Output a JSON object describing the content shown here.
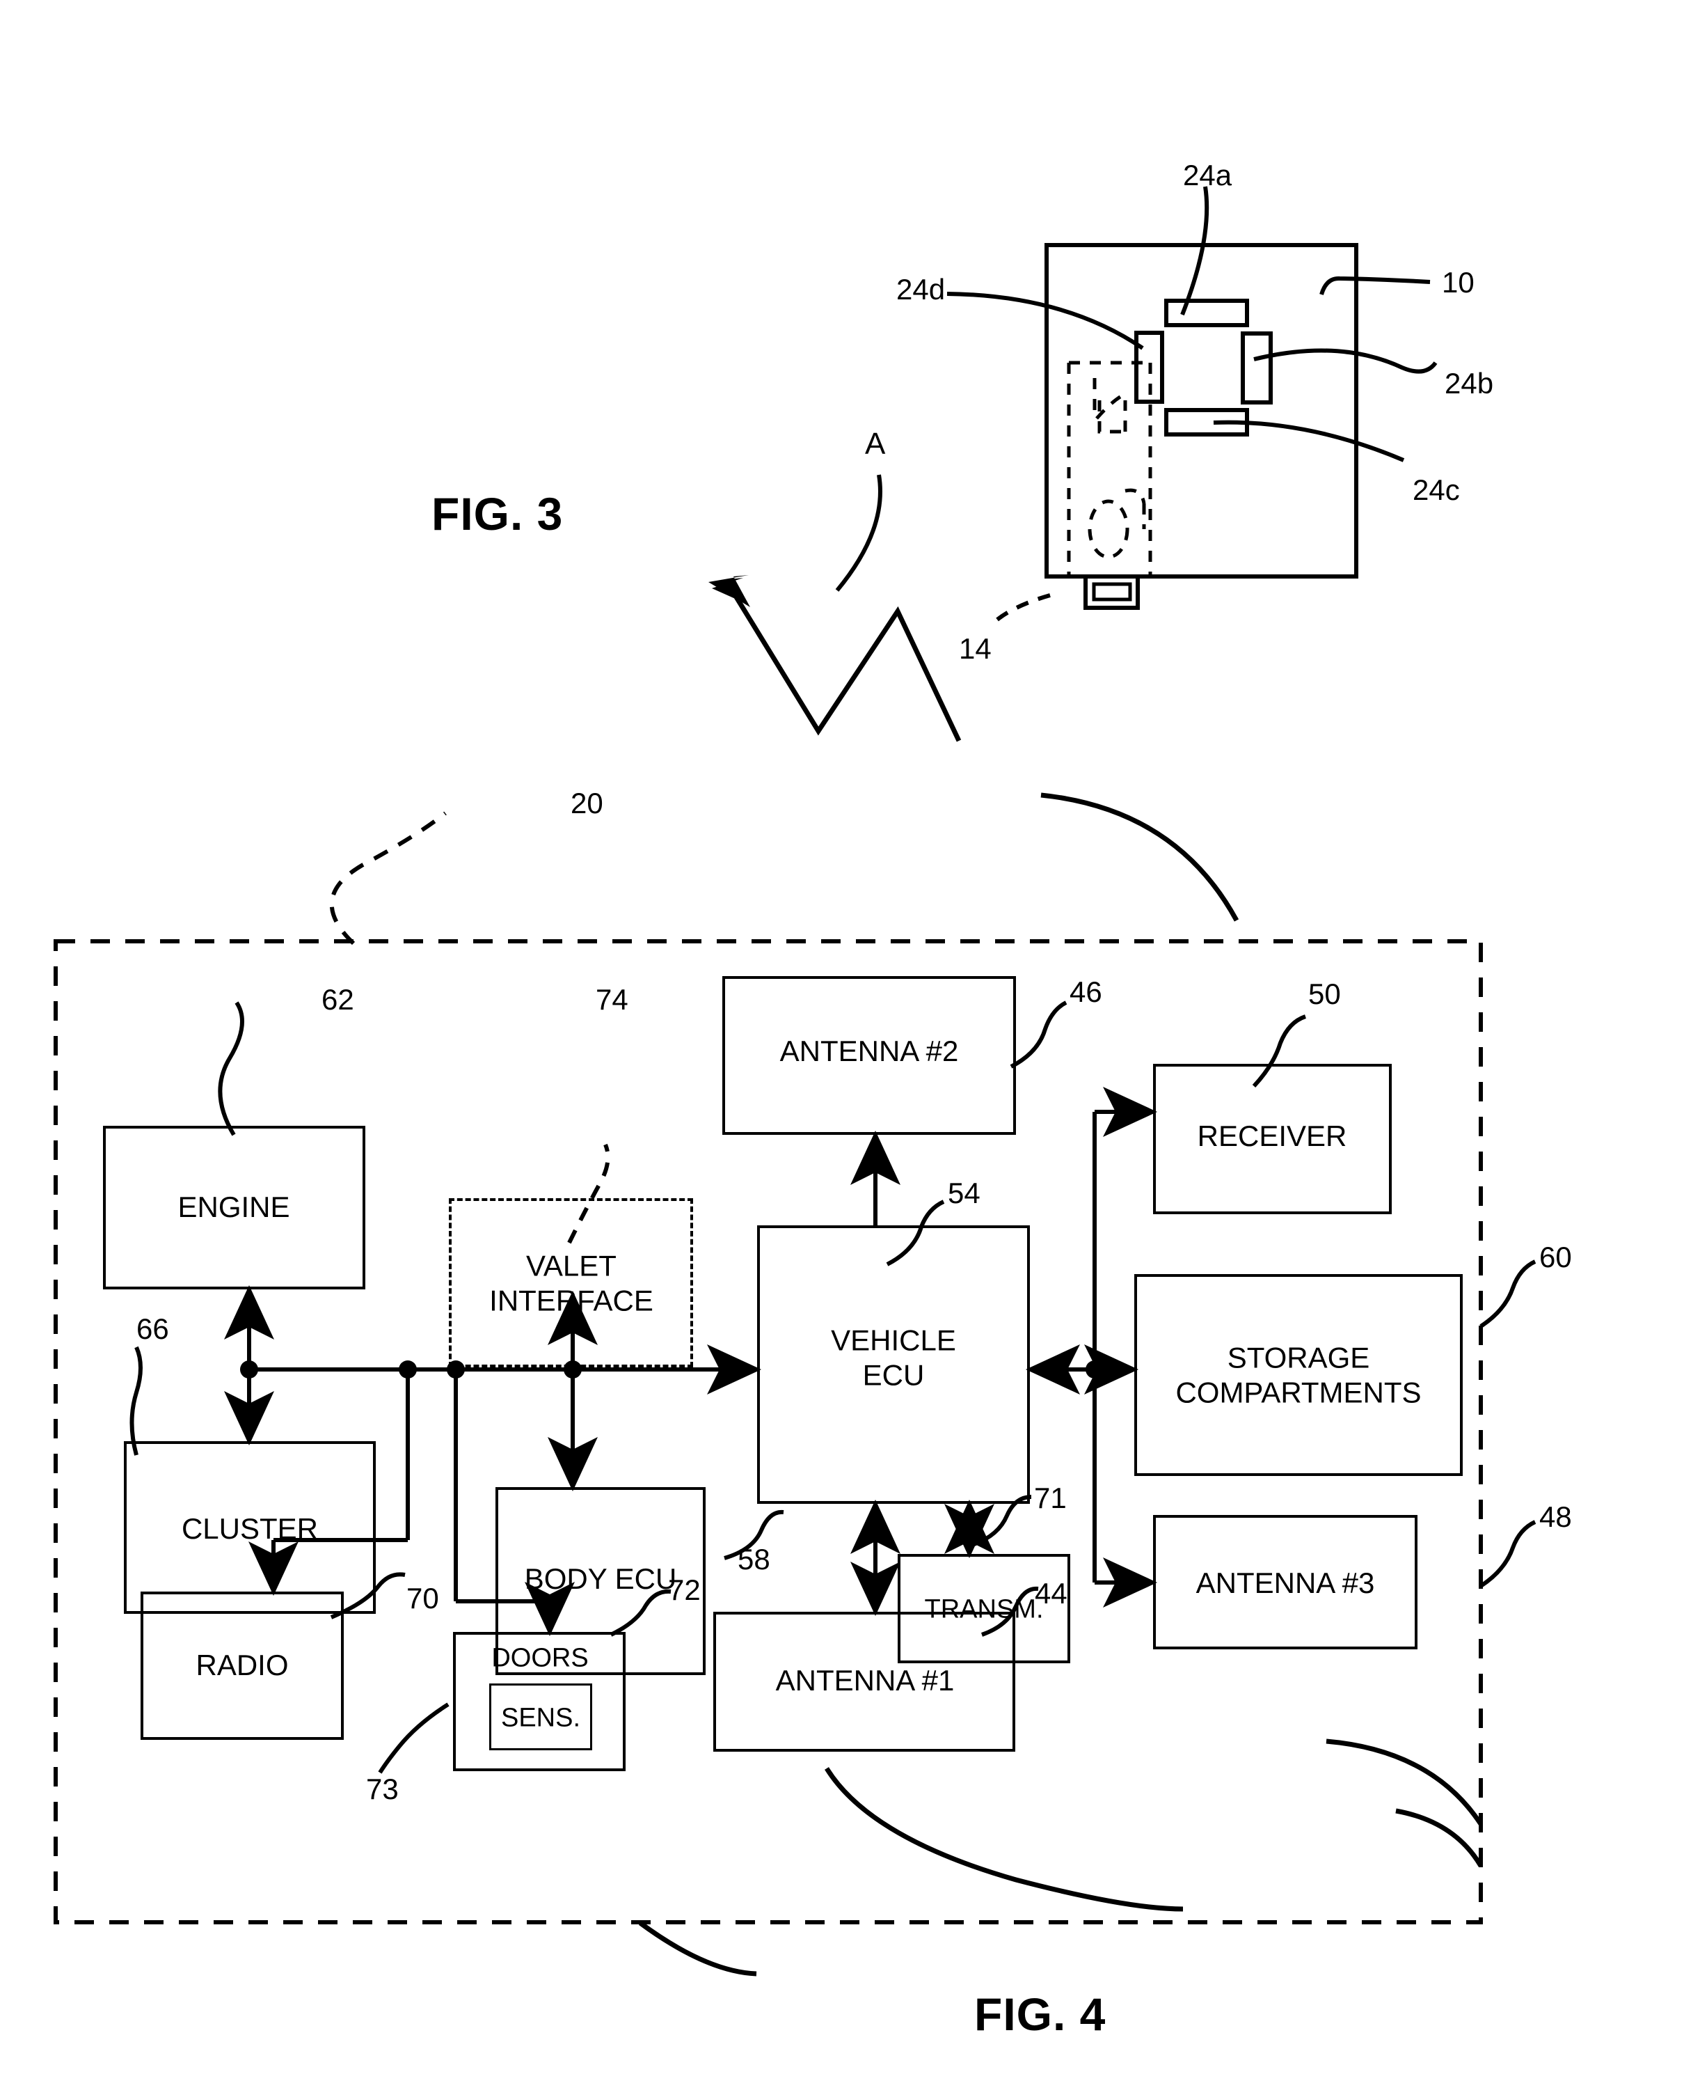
{
  "figure3": {
    "caption": "FIG. 3",
    "arrow_letter": "A",
    "refs": {
      "device": "10",
      "button_top": "24a",
      "button_right": "24b",
      "button_bottom": "24c",
      "button_left": "24d",
      "key_blade": "14"
    }
  },
  "figure4": {
    "caption": "FIG. 4",
    "refs": {
      "vehicle_boundary": "20",
      "engine": "62",
      "valet_interface": "74",
      "antenna2": "46",
      "receiver": "50",
      "vehicle_ecu": "54",
      "storage_compartments": "60",
      "cluster": "66",
      "radio": "70",
      "body_ecu": "58",
      "doors": "72",
      "door_sensor": "73",
      "antenna1": "44",
      "transmitter": "71",
      "antenna3": "48"
    },
    "blocks": {
      "engine": "ENGINE",
      "valet_interface_line1": "VALET",
      "valet_interface_line2": "INTERFACE",
      "antenna2": "ANTENNA #2",
      "receiver": "RECEIVER",
      "vehicle_ecu_line1": "VEHICLE",
      "vehicle_ecu_line2": "ECU",
      "storage_line1": "STORAGE",
      "storage_line2": "COMPARTMENTS",
      "cluster": "CLUSTER",
      "radio": "RADIO",
      "body_ecu": "BODY ECU",
      "doors": "DOORS",
      "sensor": "SENS.",
      "antenna1": "ANTENNA #1",
      "transmitter": "TRANSM.",
      "antenna3": "ANTENNA #3"
    }
  },
  "colors": {
    "ink": "#000000",
    "paper": "#ffffff"
  }
}
